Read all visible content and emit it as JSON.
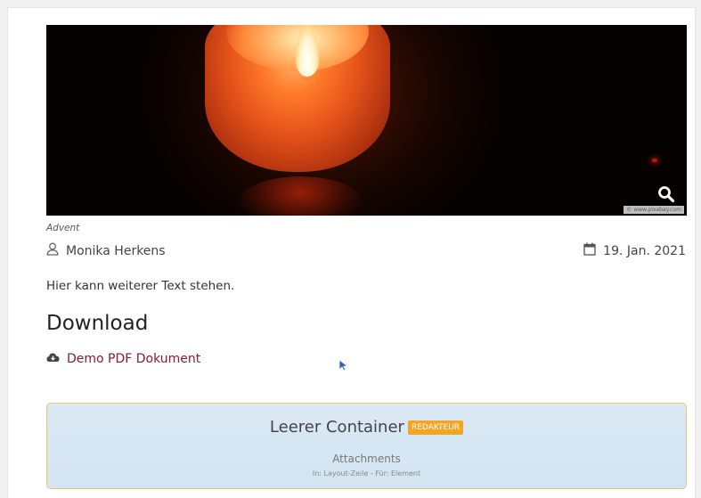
{
  "image": {
    "caption": "Advent",
    "credit": "© www.pixabay.com",
    "zoom_icon": "search-icon"
  },
  "meta": {
    "author": "Monika Herkens",
    "author_icon": "user-icon",
    "date": "19. Jan. 2021",
    "date_icon": "calendar-icon"
  },
  "body_text": "Hier kann weiterer Text stehen.",
  "download": {
    "heading": "Download",
    "link_label": "Demo PDF Dokument",
    "link_icon": "cloud-download-icon",
    "link_color": "#8b1a34"
  },
  "container": {
    "title": "Leerer Container",
    "badge": "REDAKTEUR",
    "badge_color": "#f5a524",
    "subtitle": "Attachments",
    "details": "In: Layout-Zeile - Für: Element"
  }
}
